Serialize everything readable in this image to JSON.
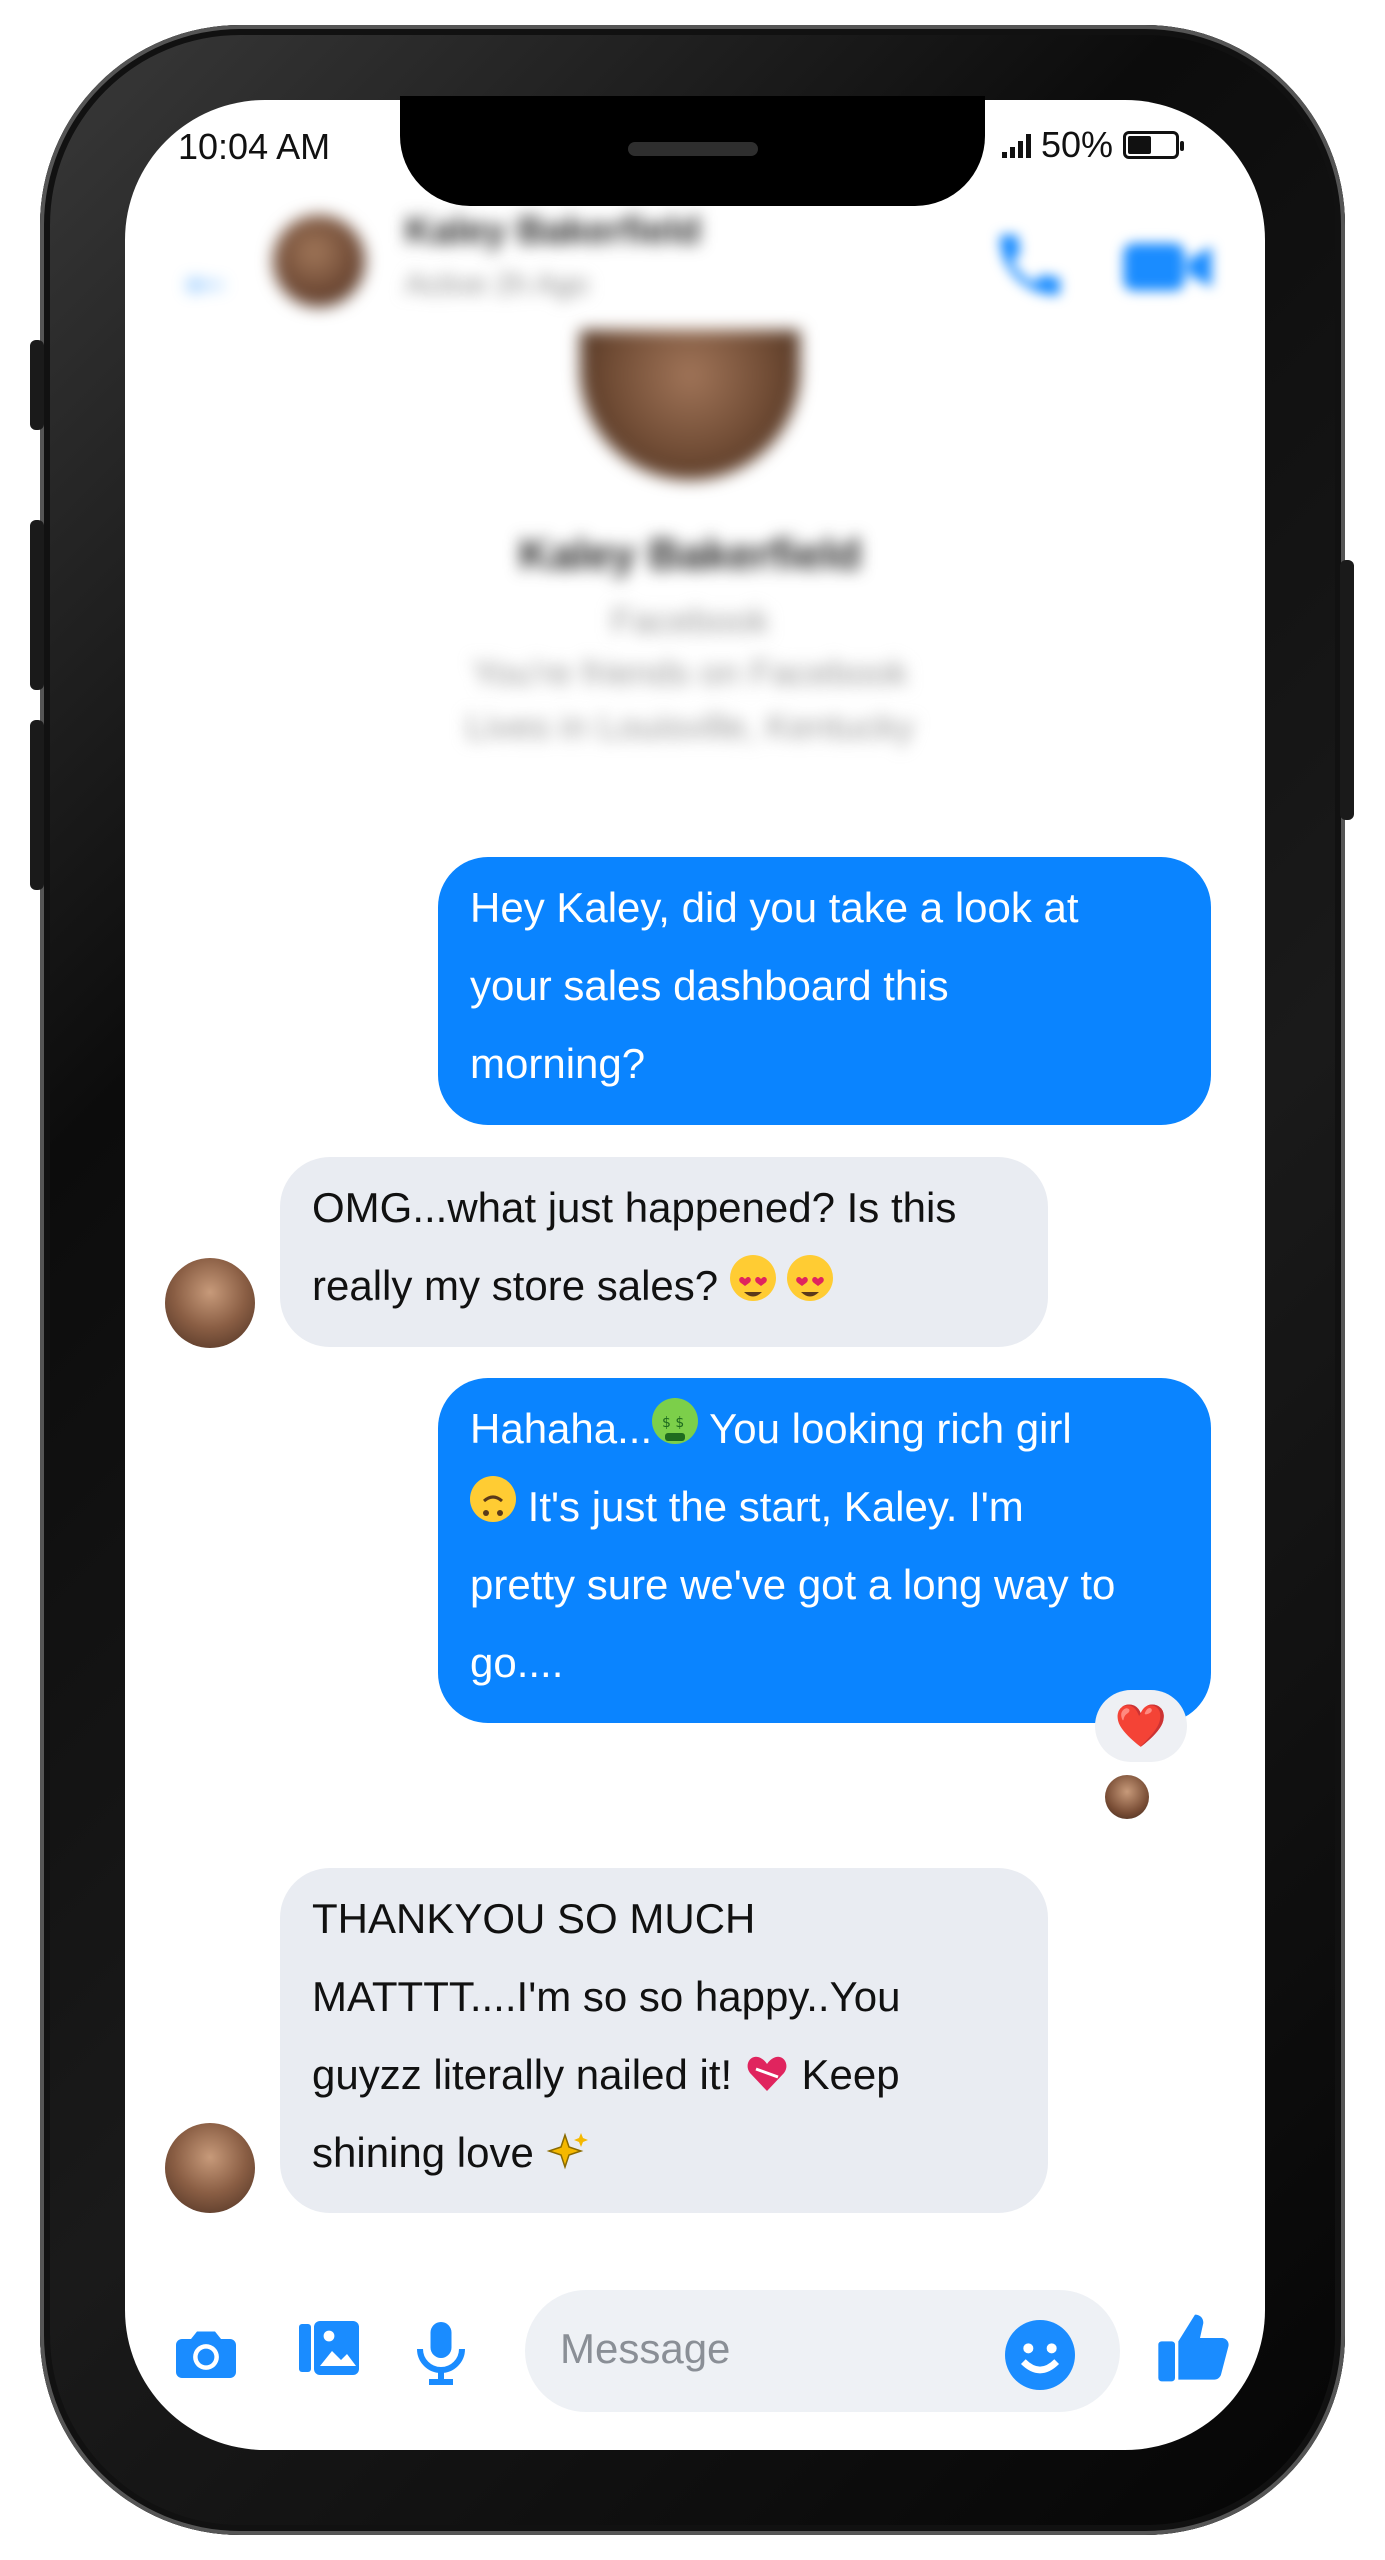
{
  "status_bar": {
    "time": "10:04 AM",
    "battery_percent": "50%",
    "battery_level": 0.5,
    "signal_icon": "signal-bars-icon",
    "battery_icon": "battery-icon"
  },
  "header": {
    "back_icon": "back-arrow-icon",
    "contact_name": "Kaley Bakerfield",
    "active_status": "Active 2h Ago",
    "call_icon": "phone-call-icon",
    "video_icon": "video-camera-icon"
  },
  "profile": {
    "name": "Kaley Bakerfield",
    "source": "Facebook",
    "friends_line": "You're friends on Facebook",
    "location_line": "Lives in Louisville, Kentucky"
  },
  "messages": [
    {
      "direction": "outgoing",
      "lines": [
        "Hey Kaley, did you take a look at",
        "your sales dashboard this",
        "morning?"
      ]
    },
    {
      "direction": "incoming",
      "lines": [
        "OMG...what just happened? Is this",
        "really my store sales?"
      ],
      "emojis": [
        "heart-eyes-emoji",
        "heart-eyes-emoji"
      ]
    },
    {
      "direction": "outgoing",
      "lines": [
        "Hahaha...",
        "You looking rich girl",
        "It's just the start, Kaley. I'm",
        "pretty sure we've got a long way to",
        "go...."
      ],
      "emojis": [
        "money-mouth-emoji",
        "upside-down-face-emoji"
      ],
      "reaction": "❤️"
    },
    {
      "direction": "incoming",
      "lines": [
        "THANKYOU SO MUCH",
        "MATTTT....I'm so so happy..You",
        "guyzz literally nailed it!",
        "Keep",
        "shining love"
      ],
      "emojis": [
        "mending-heart-emoji",
        "sparkles-emoji"
      ]
    }
  ],
  "composer": {
    "camera_icon": "camera-icon",
    "gallery_icon": "gallery-icon",
    "mic_icon": "microphone-icon",
    "placeholder": "Message",
    "emoji_icon": "smiley-icon",
    "like_icon": "thumbs-up-icon"
  },
  "colors": {
    "accent": "#0a84ff",
    "incoming_bubble": "#e9ecf2",
    "icon_blue": "#1a8cff"
  }
}
